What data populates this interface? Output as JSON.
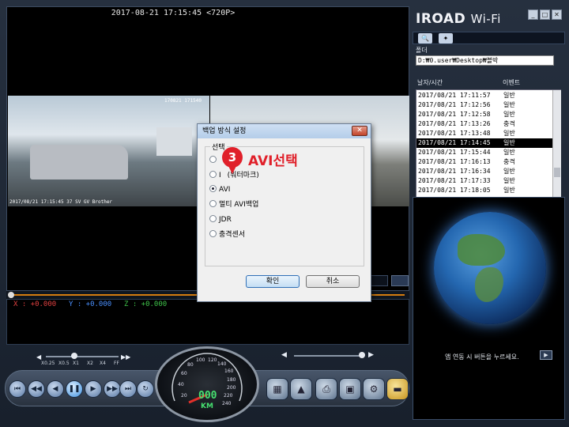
{
  "video": {
    "timestamp": "2017-08-21 17:15:45 <720P>",
    "cam1_stamp_top": "170821 171540",
    "cam1_stamp_bottom": "2017/08/21 17:15:45 37 SV  GV Brother"
  },
  "gsensor": {
    "x": "X : +0.000",
    "y": "Y : +0.000",
    "z": "Z : +0.000"
  },
  "speeds": [
    "X0.25",
    "X0.5",
    "X1",
    "X2",
    "X4",
    "FF"
  ],
  "gauge": {
    "digits": "000",
    "unit": "KM",
    "ticks": [
      "20",
      "40",
      "60",
      "80",
      "100",
      "120",
      "140",
      "160",
      "180",
      "200",
      "220",
      "240"
    ]
  },
  "app": {
    "logo": "IROAD",
    "logo_suffix": "Wi-Fi",
    "folder_label": "폴더",
    "folder_path": "D:₩0.user₩Desktop₩블박",
    "col_datetime": "날자/시간",
    "col_event": "이벤트",
    "files": [
      {
        "time": "2017/08/21 17:11:57",
        "event": "일반"
      },
      {
        "time": "2017/08/21 17:12:56",
        "event": "일반"
      },
      {
        "time": "2017/08/21 17:12:58",
        "event": "일반"
      },
      {
        "time": "2017/08/21 17:13:26",
        "event": "충격"
      },
      {
        "time": "2017/08/21 17:13:48",
        "event": "일반"
      },
      {
        "time": "2017/08/21 17:14:45",
        "event": "일반"
      },
      {
        "time": "2017/08/21 17:15:44",
        "event": "일반"
      },
      {
        "time": "2017/08/21 17:16:13",
        "event": "충격"
      },
      {
        "time": "2017/08/21 17:16:34",
        "event": "일반"
      },
      {
        "time": "2017/08/21 17:17:33",
        "event": "일반"
      },
      {
        "time": "2017/08/21 17:18:05",
        "event": "일반"
      }
    ],
    "earth_text": "앱 연동 시 버튼을 누르세요."
  },
  "dialog": {
    "title": "백업 방식 설정",
    "group_label": "선택",
    "options": [
      "AVI",
      "",
      "AVI",
      "멀티 AVI백업",
      "JDR",
      "충격센서"
    ],
    "option2_visible": "I",
    "option2_tail": "(워터마크)",
    "ok_label": "확인",
    "cancel_label": "취소"
  },
  "annotation": {
    "step": "3",
    "text": "AVI선택"
  },
  "colors": {
    "accent": "#d47c0f",
    "annotation": "#e0202a",
    "gx": "#e04040",
    "gy": "#4a90ff",
    "gz": "#3fc34a"
  }
}
